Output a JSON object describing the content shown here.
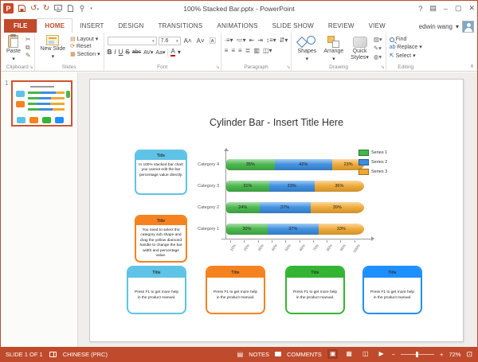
{
  "window": {
    "title": "100% Stacked Bar.pptx - PowerPoint",
    "user": "edwin wang",
    "controls": {
      "help": "?",
      "minimize": "–",
      "restore": "▢",
      "close": "✕"
    }
  },
  "tabs": {
    "file": "FILE",
    "items": [
      "HOME",
      "INSERT",
      "DESIGN",
      "TRANSITIONS",
      "ANIMATIONS",
      "SLIDE SHOW",
      "REVIEW",
      "VIEW"
    ],
    "active": "HOME"
  },
  "ribbon": {
    "clipboard": {
      "label": "Clipboard",
      "paste": "Paste"
    },
    "slides": {
      "label": "Slides",
      "new_slide": "New Slide",
      "layout": "Layout",
      "reset": "Reset",
      "section": "Section"
    },
    "font": {
      "label": "Font",
      "size": "7.6",
      "bold": "B",
      "italic": "I",
      "underline": "U",
      "strike": "S",
      "abc": "abc",
      "av": "AV",
      "aa": "Aa",
      "color": "A",
      "grow": "A",
      "shrink": "A"
    },
    "paragraph": {
      "label": "Paragraph"
    },
    "drawing": {
      "label": "Drawing",
      "shapes": "Shapes",
      "arrange": "Arrange",
      "quick": "Quick",
      "styles": "Styles"
    },
    "editing": {
      "label": "Editing",
      "find": "Find",
      "replace": "Replace",
      "select": "Select"
    }
  },
  "thumbnails": {
    "slide_number": "1"
  },
  "slide": {
    "title": "Cylinder Bar - Insert Title Here",
    "callouts": [
      {
        "title": "Title",
        "body": "In 100% stacked bar chart you cannot edit the bar percentage value directly.",
        "color": "#5ec3e6"
      },
      {
        "title": "Title",
        "body": "You need to select the category sub shape and drag the yellow diamond handle to change the bar width and percentage value.",
        "color": "#f5821f"
      }
    ],
    "info_boxes": [
      {
        "title": "Title",
        "body": "Press F1 to get more help in the product manual.",
        "color": "#5ec3e6"
      },
      {
        "title": "Title",
        "body": "Press F1 to get more help in the product manual.",
        "color": "#f5821f"
      },
      {
        "title": "Title",
        "body": "Press F1 to get more help in the product manual.",
        "color": "#33b533"
      },
      {
        "title": "Title",
        "body": "Press F1 to get more help in the product manual.",
        "color": "#1e8fff"
      }
    ]
  },
  "chart_data": {
    "type": "bar",
    "orientation": "horizontal",
    "stacked": "100%",
    "title": "",
    "categories": [
      "Category 4",
      "Category 3",
      "Category 2",
      "Category 1"
    ],
    "series": [
      {
        "name": "Series 1",
        "color": "#45b649",
        "values": [
          35,
          31,
          24,
          30
        ]
      },
      {
        "name": "Series 2",
        "color": "#3b8ee0",
        "values": [
          42,
          33,
          37,
          37
        ]
      },
      {
        "name": "Series 3",
        "color": "#f0a832",
        "values": [
          23,
          36,
          39,
          33
        ]
      }
    ],
    "rows": [
      {
        "category": "Category 4",
        "values": [
          35,
          42,
          23
        ],
        "labels": [
          "35%",
          "42%",
          "23%"
        ]
      },
      {
        "category": "Category 3",
        "values": [
          31,
          33,
          36
        ],
        "labels": [
          "31%",
          "33%",
          "36%"
        ]
      },
      {
        "category": "Category 2",
        "values": [
          24,
          37,
          39
        ],
        "labels": [
          "24%",
          "37%",
          "39%"
        ]
      },
      {
        "category": "Category 1",
        "values": [
          30,
          37,
          33
        ],
        "labels": [
          "30%",
          "37%",
          "33%"
        ]
      }
    ],
    "x_ticks": [
      "10%",
      "20%",
      "30%",
      "40%",
      "50%",
      "60%",
      "70%",
      "80%",
      "90%",
      "100%"
    ],
    "xlim": [
      0,
      100
    ],
    "grid": false,
    "legend_position": "right"
  },
  "status_bar": {
    "slide_indicator": "SLIDE 1 OF 1",
    "language": "CHINESE (PRC)",
    "notes": "NOTES",
    "comments": "COMMENTS",
    "zoom_level": "72%"
  },
  "colors": {
    "accent": "#bf4b2c",
    "series1": "#45b649",
    "series2": "#3b8ee0",
    "series3": "#f0a832"
  }
}
